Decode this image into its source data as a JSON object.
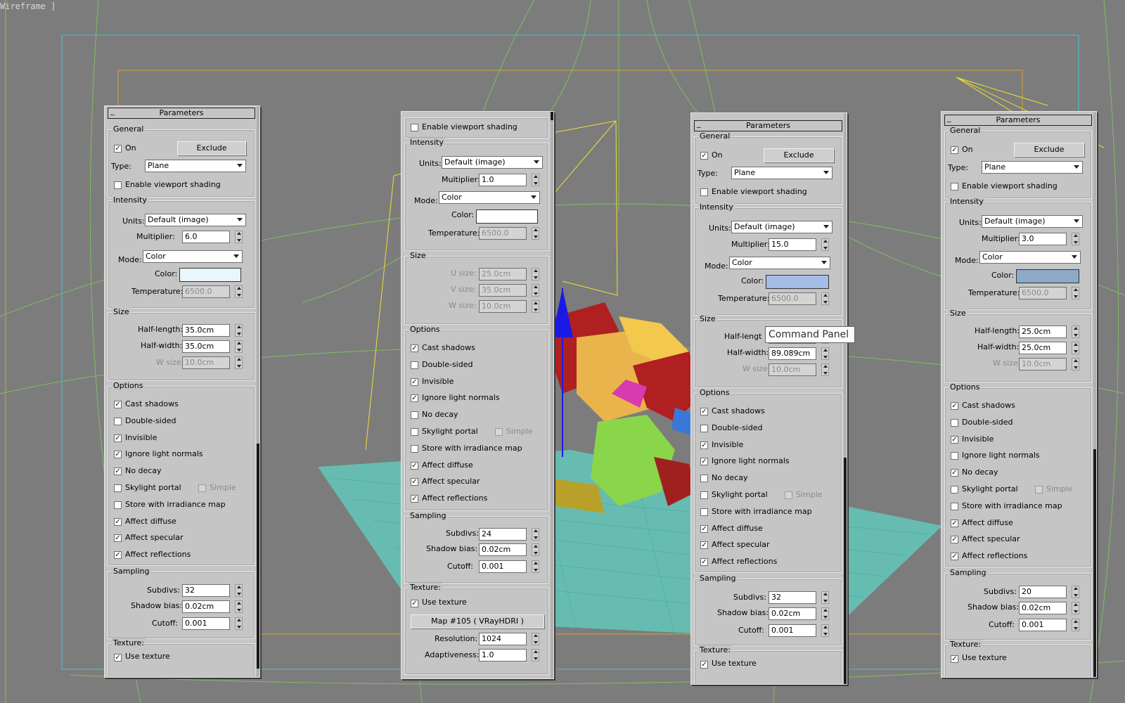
{
  "viewport": {
    "label": "Wireframe ]",
    "colors": {
      "background": "#7c7c7c",
      "frame_outer": "#3ec9d6",
      "frame_inner": "#d4a23a",
      "light_gizmo": "#f0e030",
      "floor_mesh": "#59d6c6",
      "scene_green": "#7fbf5f"
    }
  },
  "tooltip": {
    "text": "Command Panel"
  },
  "panels": [
    {
      "rollout_title": "Parameters",
      "rollout_minus": "_",
      "general": {
        "title": "General",
        "on_label": "On",
        "on": true,
        "exclude_label": "Exclude",
        "type_label": "Type:",
        "type_value": "Plane",
        "viewport_shading_label": "Enable viewport shading",
        "viewport_shading": false
      },
      "intensity": {
        "title": "Intensity",
        "units_label": "Units:",
        "units_value": "Default (image)",
        "multiplier_label": "Multiplier:",
        "multiplier_value": "6.0",
        "mode_label": "Mode:",
        "mode_value": "Color",
        "color_label": "Color:",
        "color_value": "#e9f6fb",
        "temperature_label": "Temperature:",
        "temperature_value": "6500.0"
      },
      "size": {
        "title": "Size",
        "a_label": "Half-length:",
        "a_value": "35.0cm",
        "b_label": "Half-width:",
        "b_value": "35.0cm",
        "c_label": "W size",
        "c_value": "10.0cm"
      },
      "options": {
        "title": "Options",
        "items": [
          {
            "label": "Cast shadows",
            "checked": true
          },
          {
            "label": "Double-sided",
            "checked": false
          },
          {
            "label": "Invisible",
            "checked": true
          },
          {
            "label": "Ignore light normals",
            "checked": true
          },
          {
            "label": "No decay",
            "checked": true
          },
          {
            "label": "Skylight portal",
            "checked": false
          },
          {
            "label": "Store with irradiance map",
            "checked": false
          },
          {
            "label": "Affect diffuse",
            "checked": true
          },
          {
            "label": "Affect specular",
            "checked": true
          },
          {
            "label": "Affect reflections",
            "checked": true
          }
        ],
        "simple_label": "Simple"
      },
      "sampling": {
        "title": "Sampling",
        "subdivs_label": "Subdivs:",
        "subdivs_value": "32",
        "shadow_bias_label": "Shadow bias:",
        "shadow_bias_value": "0.02cm",
        "cutoff_label": "Cutoff:",
        "cutoff_value": "0.001"
      },
      "texture": {
        "title": "Texture:",
        "use_texture_label": "Use texture",
        "use_texture": true
      }
    },
    {
      "general": {
        "viewport_shading_label": "Enable viewport shading",
        "viewport_shading": false
      },
      "intensity": {
        "title": "Intensity",
        "units_label": "Units:",
        "units_value": "Default (image)",
        "multiplier_label": "Multiplier:",
        "multiplier_value": "1.0",
        "mode_label": "Mode:",
        "mode_value": "Color",
        "color_label": "Color:",
        "color_value": "#ffffff",
        "temperature_label": "Temperature:",
        "temperature_value": "6500.0"
      },
      "size": {
        "title": "Size",
        "a_label": "U size:",
        "a_value": "25.0cm",
        "b_label": "V size:",
        "b_value": "35.0cm",
        "c_label": "W size:",
        "c_value": "10.0cm"
      },
      "options": {
        "title": "Options",
        "items": [
          {
            "label": "Cast shadows",
            "checked": true
          },
          {
            "label": "Double-sided",
            "checked": false
          },
          {
            "label": "Invisible",
            "checked": true
          },
          {
            "label": "Ignore light normals",
            "checked": true
          },
          {
            "label": "No decay",
            "checked": false
          },
          {
            "label": "Skylight portal",
            "checked": false
          },
          {
            "label": "Store with irradiance map",
            "checked": false
          },
          {
            "label": "Affect diffuse",
            "checked": true
          },
          {
            "label": "Affect specular",
            "checked": true
          },
          {
            "label": "Affect reflections",
            "checked": true
          }
        ],
        "simple_label": "Simple"
      },
      "sampling": {
        "title": "Sampling",
        "subdivs_label": "Subdivs:",
        "subdivs_value": "24",
        "shadow_bias_label": "Shadow bias:",
        "shadow_bias_value": "0.02cm",
        "cutoff_label": "Cutoff:",
        "cutoff_value": "0.001"
      },
      "texture": {
        "title": "Texture:",
        "use_texture_label": "Use texture",
        "use_texture": true,
        "map_label": "Map #105  ( VRayHDRI )",
        "resolution_label": "Resolution:",
        "resolution_value": "1024",
        "adaptiveness_label": "Adaptiveness:",
        "adaptiveness_value": "1.0"
      }
    },
    {
      "rollout_title": "Parameters",
      "rollout_minus": "_",
      "general": {
        "title": "General",
        "on_label": "On",
        "on": true,
        "exclude_label": "Exclude",
        "type_label": "Type:",
        "type_value": "Plane",
        "viewport_shading_label": "Enable viewport shading",
        "viewport_shading": false
      },
      "intensity": {
        "title": "Intensity",
        "units_label": "Units:",
        "units_value": "Default (image)",
        "multiplier_label": "Multiplier:",
        "multiplier_value": "15.0",
        "mode_label": "Mode:",
        "mode_value": "Color",
        "color_label": "Color:",
        "color_value": "#a4bce6",
        "temperature_label": "Temperature:",
        "temperature_value": "6500.0"
      },
      "size": {
        "title": "Size",
        "a_label": "Half-lengt",
        "a_value": "",
        "b_label": "Half-width:",
        "b_value": "89.089cm",
        "c_label": "W size",
        "c_value": "10.0cm"
      },
      "options": {
        "title": "Options",
        "items": [
          {
            "label": "Cast shadows",
            "checked": true
          },
          {
            "label": "Double-sided",
            "checked": false
          },
          {
            "label": "Invisible",
            "checked": true
          },
          {
            "label": "Ignore light normals",
            "checked": true
          },
          {
            "label": "No decay",
            "checked": false
          },
          {
            "label": "Skylight portal",
            "checked": false
          },
          {
            "label": "Store with irradiance map",
            "checked": false
          },
          {
            "label": "Affect diffuse",
            "checked": true
          },
          {
            "label": "Affect specular",
            "checked": true
          },
          {
            "label": "Affect reflections",
            "checked": true
          }
        ],
        "simple_label": "Simple"
      },
      "sampling": {
        "title": "Sampling",
        "subdivs_label": "Subdivs:",
        "subdivs_value": "32",
        "shadow_bias_label": "Shadow bias:",
        "shadow_bias_value": "0.02cm",
        "cutoff_label": "Cutoff:",
        "cutoff_value": "0.001"
      },
      "texture": {
        "title": "Texture:",
        "use_texture_label": "Use texture",
        "use_texture": true
      }
    },
    {
      "rollout_title": "Parameters",
      "rollout_minus": "_",
      "general": {
        "title": "General",
        "on_label": "On",
        "on": true,
        "exclude_label": "Exclude",
        "type_label": "Type:",
        "type_value": "Plane",
        "viewport_shading_label": "Enable viewport shading",
        "viewport_shading": false
      },
      "intensity": {
        "title": "Intensity",
        "units_label": "Units:",
        "units_value": "Default (image)",
        "multiplier_label": "Multiplier:",
        "multiplier_value": "3.0",
        "mode_label": "Mode:",
        "mode_value": "Color",
        "color_label": "Color:",
        "color_value": "#8caac8",
        "temperature_label": "Temperature:",
        "temperature_value": "6500.0"
      },
      "size": {
        "title": "Size",
        "a_label": "Half-length:",
        "a_value": "25.0cm",
        "b_label": "Half-width:",
        "b_value": "25.0cm",
        "c_label": "W size",
        "c_value": "10.0cm"
      },
      "options": {
        "title": "Options",
        "items": [
          {
            "label": "Cast shadows",
            "checked": true
          },
          {
            "label": "Double-sided",
            "checked": false
          },
          {
            "label": "Invisible",
            "checked": true
          },
          {
            "label": "Ignore light normals",
            "checked": false
          },
          {
            "label": "No decay",
            "checked": true
          },
          {
            "label": "Skylight portal",
            "checked": false
          },
          {
            "label": "Store with irradiance map",
            "checked": false
          },
          {
            "label": "Affect diffuse",
            "checked": true
          },
          {
            "label": "Affect specular",
            "checked": true
          },
          {
            "label": "Affect reflections",
            "checked": true
          }
        ],
        "simple_label": "Simple"
      },
      "sampling": {
        "title": "Sampling",
        "subdivs_label": "Subdivs:",
        "subdivs_value": "20",
        "shadow_bias_label": "Shadow bias:",
        "shadow_bias_value": "0.02cm",
        "cutoff_label": "Cutoff:",
        "cutoff_value": "0.001"
      },
      "texture": {
        "title": "Texture:",
        "use_texture_label": "Use texture",
        "use_texture": true
      }
    }
  ]
}
